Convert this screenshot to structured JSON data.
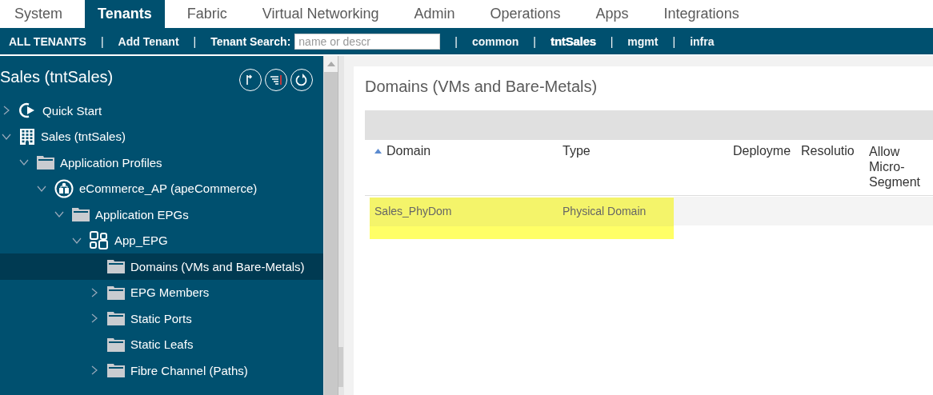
{
  "top_tabs": [
    {
      "label": "System",
      "selected": false
    },
    {
      "label": "Tenants",
      "selected": true
    },
    {
      "label": "Fabric",
      "selected": false
    },
    {
      "label": "Virtual Networking",
      "selected": false
    },
    {
      "label": "Admin",
      "selected": false
    },
    {
      "label": "Operations",
      "selected": false
    },
    {
      "label": "Apps",
      "selected": false
    },
    {
      "label": "Integrations",
      "selected": false
    }
  ],
  "sub_nav": {
    "items": [
      {
        "kind": "link",
        "label": "ALL TENANTS",
        "selected": false
      },
      {
        "kind": "link",
        "label": "Add Tenant",
        "selected": false
      },
      {
        "kind": "search",
        "label": "Tenant Search:",
        "placeholder": "name or descr"
      },
      {
        "kind": "link",
        "label": "common",
        "selected": false
      },
      {
        "kind": "link",
        "label": "tntSales",
        "selected": true
      },
      {
        "kind": "link",
        "label": "mgmt",
        "selected": false
      },
      {
        "kind": "link",
        "label": "infra",
        "selected": false
      }
    ],
    "separator": "|"
  },
  "sidebar": {
    "title": "Sales (tntSales)",
    "tree": [
      {
        "label": "Quick Start",
        "kind": "quickstart",
        "expanded": false,
        "selected": false
      },
      {
        "label": "Sales (tntSales)",
        "kind": "tenant",
        "expanded": true,
        "selected": false,
        "children": [
          {
            "label": "Application Profiles",
            "kind": "folder",
            "expanded": true,
            "selected": false,
            "children": [
              {
                "label": "eCommerce_AP (apeCommerce)",
                "kind": "app-profile",
                "expanded": true,
                "selected": false,
                "children": [
                  {
                    "label": "Application EPGs",
                    "kind": "folder",
                    "expanded": true,
                    "selected": false,
                    "children": [
                      {
                        "label": "App_EPG",
                        "kind": "epg",
                        "expanded": true,
                        "selected": false,
                        "children": [
                          {
                            "label": "Domains (VMs and Bare-Metals)",
                            "kind": "folder",
                            "selected": true
                          },
                          {
                            "label": "EPG Members",
                            "kind": "folder",
                            "expanded": false,
                            "selected": false
                          },
                          {
                            "label": "Static Ports",
                            "kind": "folder",
                            "expanded": false,
                            "selected": false
                          },
                          {
                            "label": "Static Leafs",
                            "kind": "folder",
                            "selected": false
                          },
                          {
                            "label": "Fibre Channel (Paths)",
                            "kind": "folder",
                            "expanded": false,
                            "selected": false
                          }
                        ]
                      }
                    ]
                  }
                ]
              }
            ]
          }
        ]
      }
    ]
  },
  "content": {
    "title": "Domains (VMs and Bare-Metals)",
    "table": {
      "columns": [
        {
          "label": "Domain",
          "sort_ascending": true
        },
        {
          "label": "Type"
        },
        {
          "label": "Deployme"
        },
        {
          "label": "Resolutio"
        },
        {
          "label": "Allow Micro-Segment"
        }
      ],
      "rows": [
        {
          "cells": [
            "Sales_PhyDom",
            "Physical Domain"
          ],
          "highlighted": true
        }
      ]
    }
  }
}
